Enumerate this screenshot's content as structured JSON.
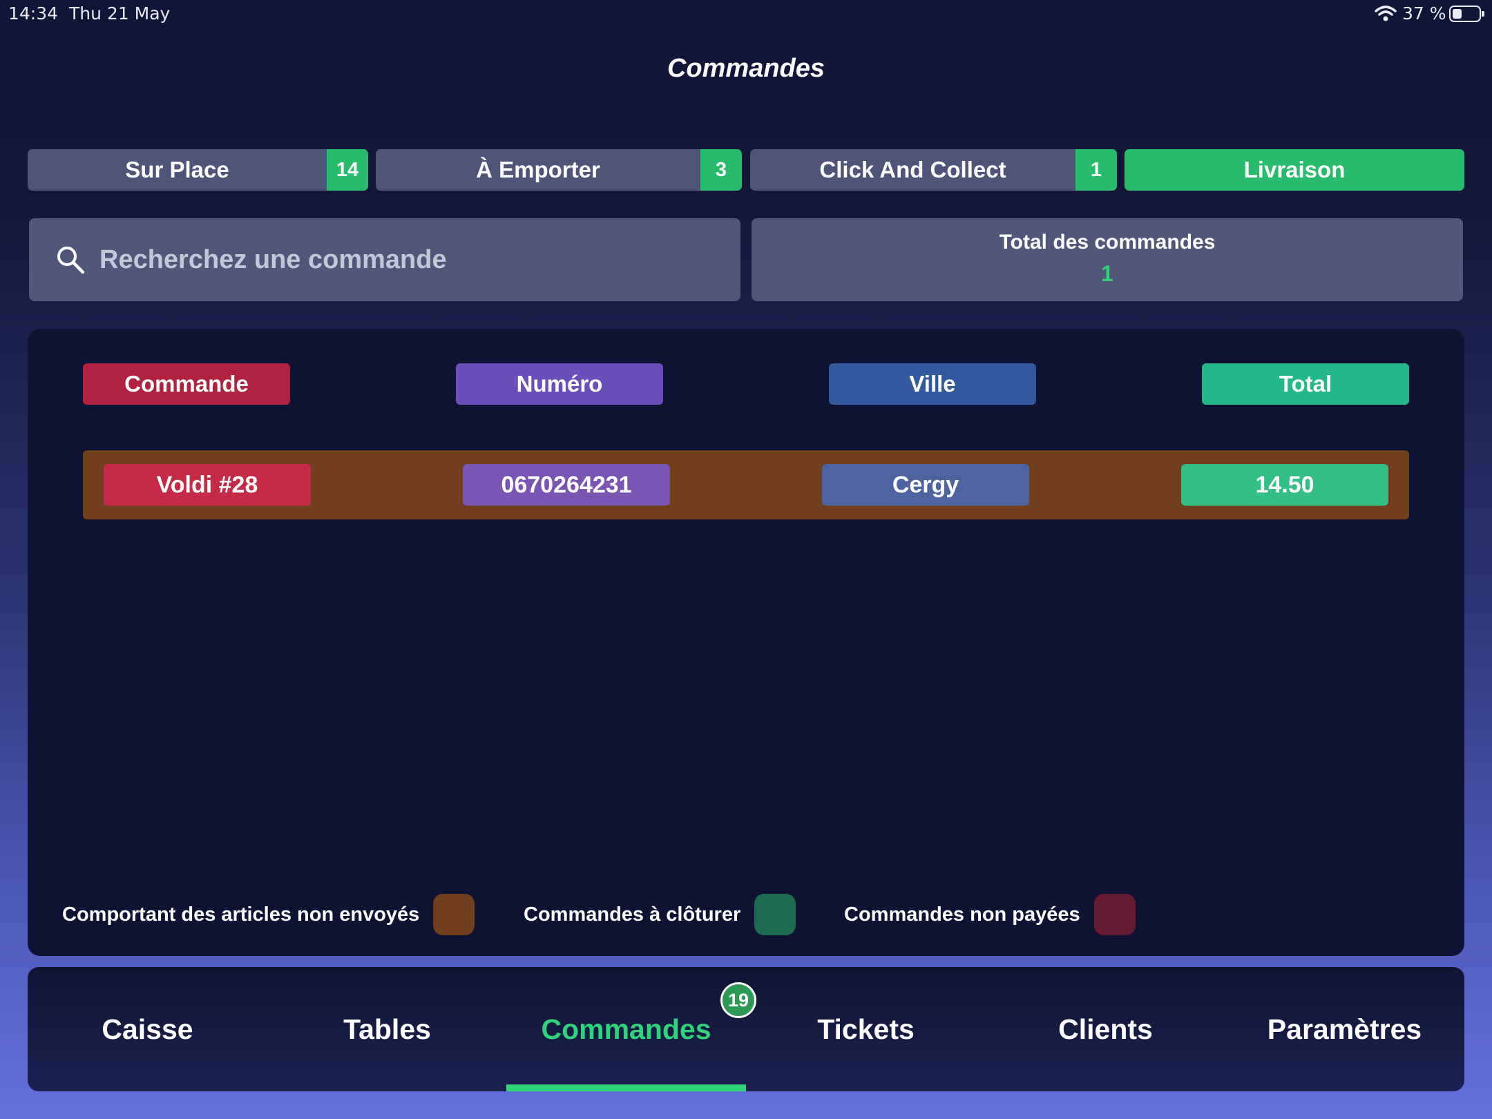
{
  "status_bar": {
    "time": "14:34",
    "date": "Thu 21 May",
    "battery": "37 %",
    "battery_level": 0.37
  },
  "header": {
    "title": "Commandes"
  },
  "order_types": [
    {
      "label": "Sur Place",
      "count": "14"
    },
    {
      "label": "À Emporter",
      "count": "3"
    },
    {
      "label": "Click And Collect",
      "count": "1"
    },
    {
      "label": "Livraison",
      "active": true
    }
  ],
  "search": {
    "placeholder": "Recherchez une commande",
    "value": ""
  },
  "summary": {
    "label": "Total des commandes",
    "value": "1"
  },
  "table": {
    "columns": [
      "Commande",
      "Numéro",
      "Ville",
      "Total"
    ],
    "rows": [
      {
        "commande": "Voldi #28",
        "numero": "0670264231",
        "ville": "Cergy",
        "total": "14.50"
      }
    ]
  },
  "legend": [
    {
      "label": "Comportant des articles non envoyés",
      "color": "#713e1e"
    },
    {
      "label": "Commandes à clôturer",
      "color": "#1a6b50"
    },
    {
      "label": "Commandes non payées",
      "color": "#651c32"
    }
  ],
  "bottom_nav": {
    "items": [
      "Caisse",
      "Tables",
      "Commandes",
      "Tickets",
      "Clients",
      "Paramètres"
    ],
    "active": "Commandes",
    "badge": "19"
  },
  "colors": {
    "accent_green": "#27bb6c",
    "header_commande": "#b0223f",
    "header_numero": "#6a4fba",
    "header_ville": "#335a9e",
    "header_total": "#22b889",
    "cell_commande": "#c52b47",
    "cell_numero": "#7a54b3",
    "cell_ville": "#4d64a0",
    "cell_total": "#34bf87"
  }
}
